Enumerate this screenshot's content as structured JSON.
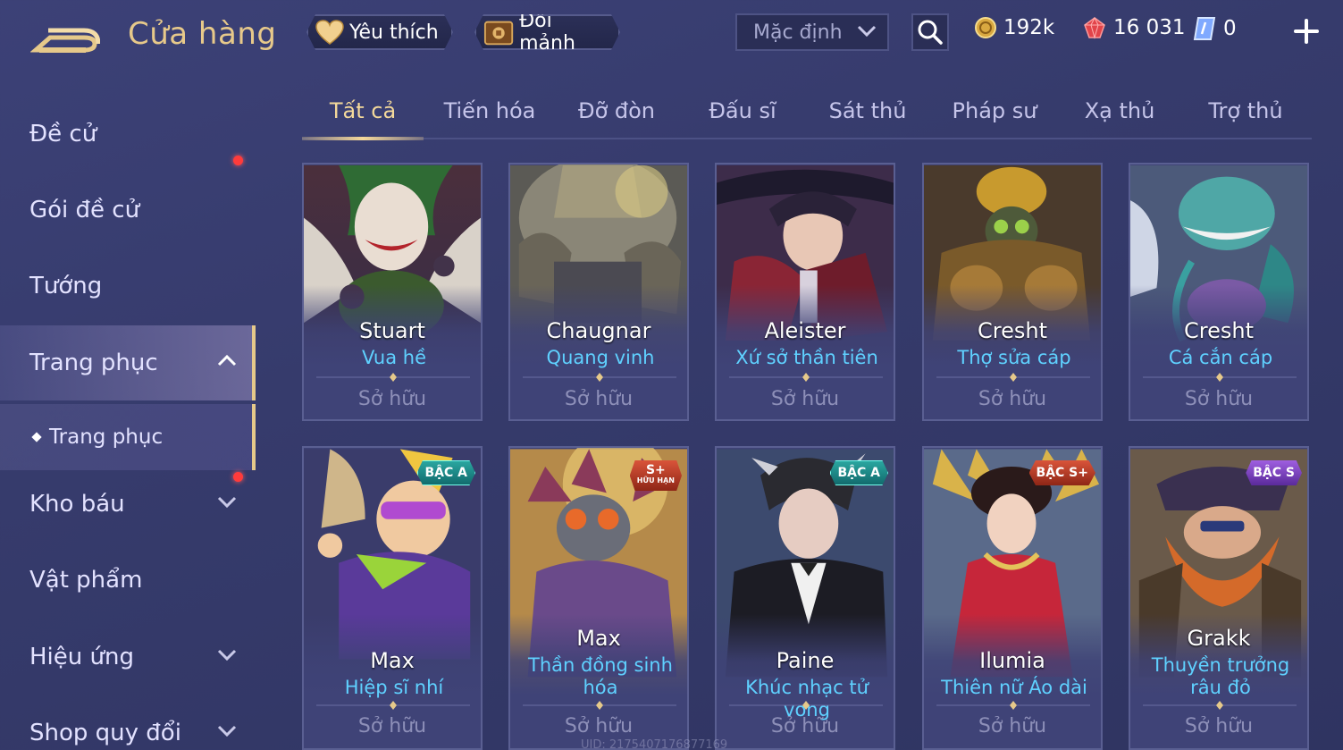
{
  "header": {
    "title": "Cửa hàng",
    "favorites_label": "Yêu thích",
    "shard_exchange_label": "Đổi mảnh",
    "sort": {
      "selected": "Mặc định"
    },
    "currencies": [
      {
        "icon": "gold-coin-icon",
        "value": "192k"
      },
      {
        "icon": "red-gem-icon",
        "value": "16 031"
      },
      {
        "icon": "ticket-icon",
        "value": "0"
      }
    ]
  },
  "sidebar": {
    "items": [
      {
        "label": "Đề cử"
      },
      {
        "label": "Gói đề cử"
      },
      {
        "label": "Tướng"
      },
      {
        "label": "Trang phục"
      },
      {
        "label": "Trang phục"
      },
      {
        "label": "Kho báu"
      },
      {
        "label": "Vật phẩm"
      },
      {
        "label": "Hiệu ứng"
      },
      {
        "label": "Shop quy đổi"
      }
    ]
  },
  "tabs": [
    {
      "label": "Tất cả"
    },
    {
      "label": "Tiến hóa"
    },
    {
      "label": "Đỡ đòn"
    },
    {
      "label": "Đấu sĩ"
    },
    {
      "label": "Sát thủ"
    },
    {
      "label": "Pháp sư"
    },
    {
      "label": "Xạ thủ"
    },
    {
      "label": "Trợ thủ"
    }
  ],
  "skins": [
    {
      "hero": "Stuart",
      "skin": "Vua hề",
      "status": "Sở hữu",
      "tier": ""
    },
    {
      "hero": "Chaugnar",
      "skin": "Quang vinh",
      "status": "Sở hữu",
      "tier": ""
    },
    {
      "hero": "Aleister",
      "skin": "Xứ sở thần tiên",
      "status": "Sở hữu",
      "tier": ""
    },
    {
      "hero": "Cresht",
      "skin": "Thợ sửa cáp",
      "status": "Sở hữu",
      "tier": ""
    },
    {
      "hero": "Cresht",
      "skin": "Cá cắn cáp",
      "status": "Sở hữu",
      "tier": ""
    },
    {
      "hero": "Max",
      "skin": "Hiệp sĩ nhí",
      "status": "Sở hữu",
      "tier": "BẬC A"
    },
    {
      "hero": "Max",
      "skin": "Thần đồng sinh hóa",
      "status": "Sở hữu",
      "tier": "S+",
      "tier_sub": "HỮU HẠN"
    },
    {
      "hero": "Paine",
      "skin": "Khúc nhạc tử vong",
      "status": "Sở hữu",
      "tier": "BẬC A"
    },
    {
      "hero": "Ilumia",
      "skin": "Thiên nữ Áo dài",
      "status": "Sở hữu",
      "tier": "BẬC S+"
    },
    {
      "hero": "Grakk",
      "skin": "Thuyền trưởng râu đỏ",
      "status": "Sở hữu",
      "tier": "BẬC S"
    }
  ],
  "footer": {
    "uid": "UID: 2175407176877169"
  },
  "colors": {
    "gold": "#e7c98a",
    "skin_name": "#5fd1ff",
    "badge_red": "#ff3b3b"
  }
}
